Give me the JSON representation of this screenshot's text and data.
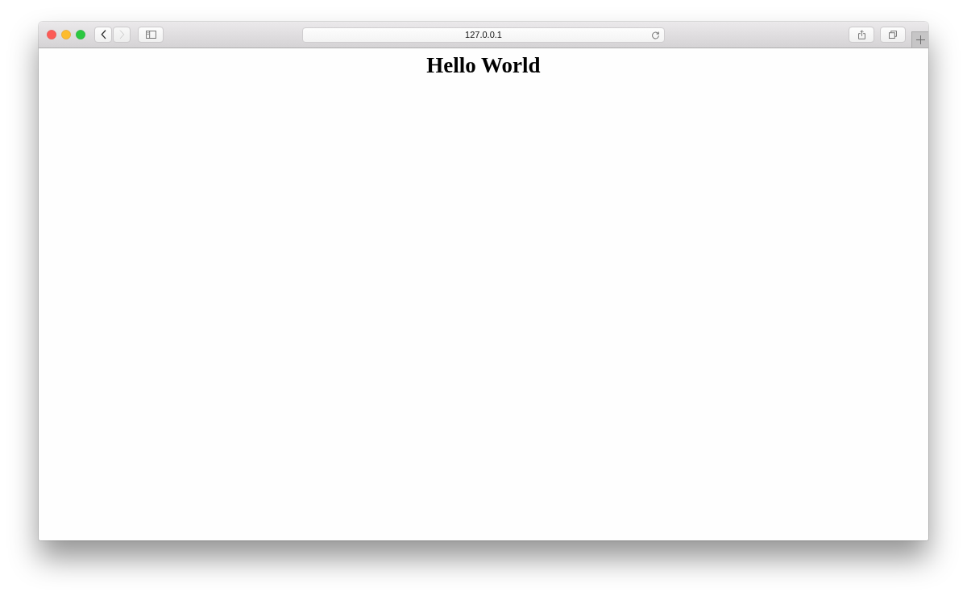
{
  "toolbar": {
    "nav_buttons": [
      {
        "kind": "back",
        "disabled": false
      },
      {
        "kind": "forward",
        "disabled": true
      }
    ],
    "address_bar": {
      "value": "127.0.0.1"
    }
  },
  "page": {
    "heading": "Hello World"
  }
}
